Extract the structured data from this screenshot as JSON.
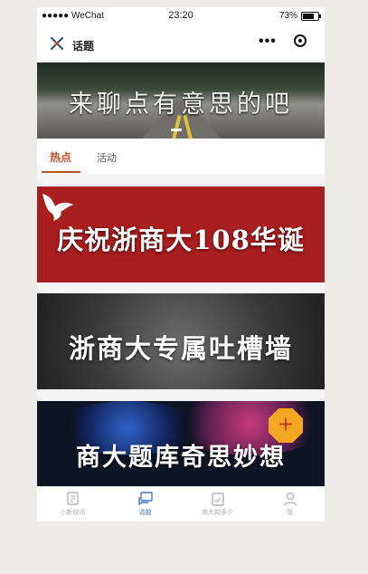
{
  "status_bar": {
    "carrier": "●●●●● WeChat",
    "time": "23:20",
    "battery": "73%",
    "battery_level": 0.73
  },
  "navbar": {
    "title": "话题"
  },
  "hero": {
    "caption": "来聊点有意思的吧"
  },
  "tabs": [
    {
      "label": "热点",
      "active": true
    },
    {
      "label": "活动",
      "active": false
    }
  ],
  "cards": [
    {
      "title": "庆祝浙商大108华诞"
    },
    {
      "title": "浙商大专属吐槽墙"
    },
    {
      "title": "商大题库奇思妙想"
    }
  ],
  "fab": {
    "label": "+"
  },
  "tabbar": [
    {
      "label": "小新校讯",
      "icon": "news-icon",
      "active": false
    },
    {
      "label": "话题",
      "icon": "chat-icon",
      "active": true
    },
    {
      "label": "商大知多少",
      "icon": "clipboard-check-icon",
      "active": false
    },
    {
      "label": "我",
      "icon": "person-icon",
      "active": false
    }
  ],
  "colors": {
    "accent": "#c0502a",
    "tab_active": "#3f76c2",
    "card1_bg": "#a91e1f",
    "fab_bg": "#f5a622"
  }
}
